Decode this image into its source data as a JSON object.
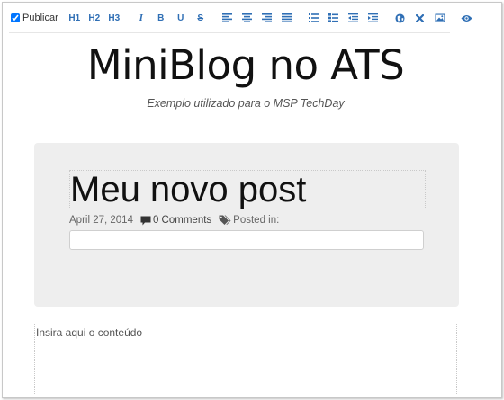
{
  "toolbar": {
    "publish_label": "Publicar",
    "publish_checked": true,
    "headings": [
      "H1",
      "H2",
      "H3"
    ],
    "icon_color": "#2f6fb5"
  },
  "header": {
    "title": "MiniBlog no ATS",
    "subtitle": "Exemplo utilizado para o MSP TechDay"
  },
  "post": {
    "title": "Meu novo post",
    "date": "April 27, 2014",
    "comments": "0 Comments",
    "posted_in": "Posted in:",
    "categories_value": ""
  },
  "content": {
    "placeholder": "Insira aqui o conteúdo"
  }
}
